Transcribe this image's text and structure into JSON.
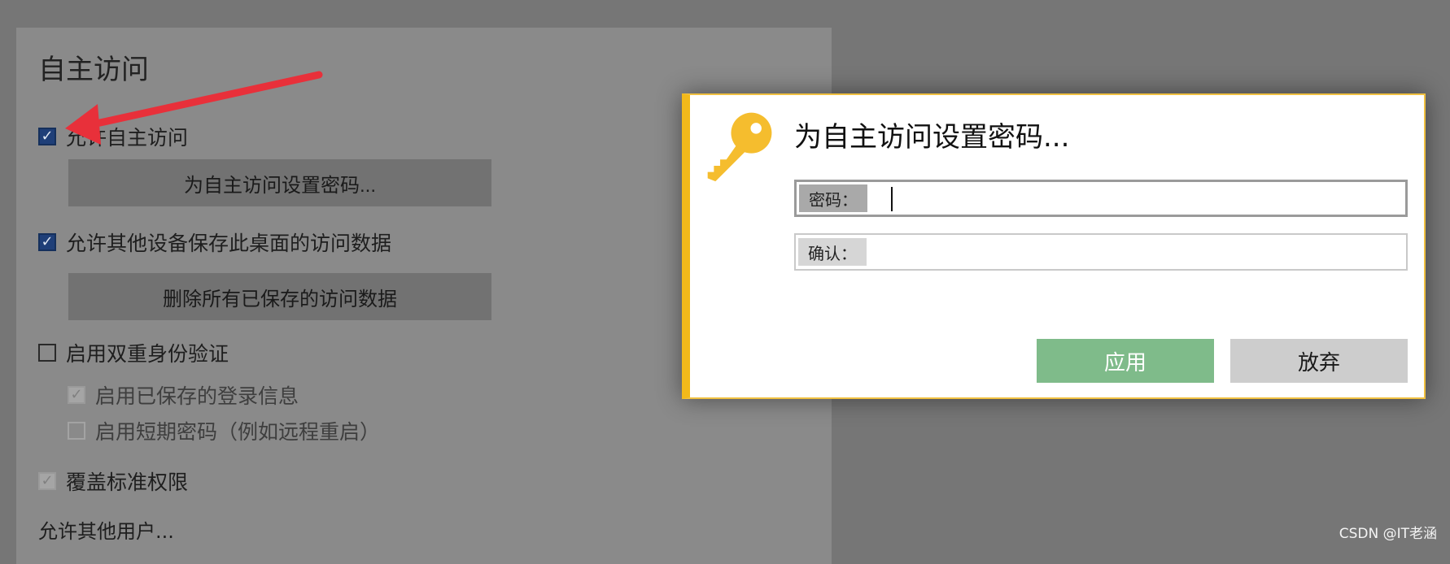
{
  "panel": {
    "title": "自主访问",
    "allow_access_label": "允许自主访问",
    "set_password_button": "为自主访问设置密码...",
    "allow_save_data_label": "允许其他设备保存此桌面的访问数据",
    "delete_saved_button": "删除所有已保存的访问数据",
    "two_factor_label": "启用双重身份验证",
    "saved_login_label": "启用已保存的登录信息",
    "short_password_label": "启用短期密码（例如远程重启）",
    "override_permissions_label": "覆盖标准权限",
    "allow_other_users_link": "允许其他用户..."
  },
  "dialog": {
    "title": "为自主访问设置密码...",
    "password_label": "密码：",
    "password_value": "",
    "confirm_label": "确认：",
    "confirm_value": "",
    "apply_button": "应用",
    "cancel_button": "放弃",
    "icon": "key-icon"
  },
  "colors": {
    "dialog_accent": "#f2b91b",
    "apply_button": "#7fbb8a",
    "annotation_arrow": "#e8303a"
  },
  "watermark": "CSDN @IT老涵"
}
